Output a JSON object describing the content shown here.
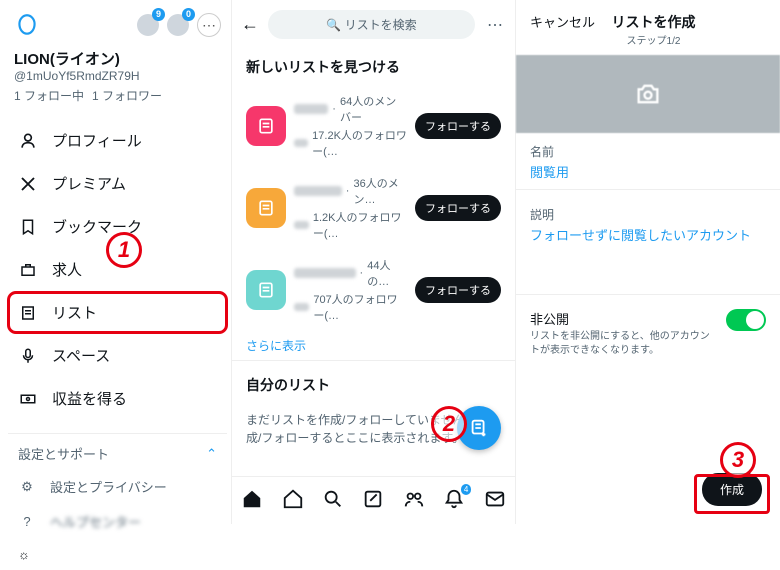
{
  "sidebar": {
    "badge1": "9",
    "badge2": "0",
    "profile": {
      "name": "LION(ライオン)",
      "handle": "@1mUoYf5RmdZR79H",
      "following": "1 フォロー中",
      "followers": "1 フォロワー"
    },
    "items": [
      {
        "key": "profile",
        "label": "プロフィール"
      },
      {
        "key": "premium",
        "label": "プレミアム"
      },
      {
        "key": "bookmark",
        "label": "ブックマーク"
      },
      {
        "key": "jobs",
        "label": "求人"
      },
      {
        "key": "lists",
        "label": "リスト"
      },
      {
        "key": "spaces",
        "label": "スペース"
      },
      {
        "key": "monetize",
        "label": "収益を得る"
      }
    ],
    "sectionLabel": "設定とサポート",
    "sub": {
      "settings": "設定とプライバシー",
      "help": "ヘルプセンター"
    }
  },
  "mid": {
    "searchPlaceholder": "リストを検索",
    "findLists": "新しいリストを見つける",
    "suggestions": [
      {
        "color": "pink",
        "members": "64人のメンバー",
        "followers": "17.2K人のフォロワー(…"
      },
      {
        "color": "orange",
        "members": "36人のメン…",
        "followers": "1.2K人のフォロワー(…"
      },
      {
        "color": "teal",
        "members": "44人の…",
        "followers": "707人のフォロワー(…"
      }
    ],
    "followLabel": "フォローする",
    "moreLink": "さらに表示",
    "ownLists": "自分のリスト",
    "empty": "まだリストを作成/フォローしていません。作成/フォローするとここに表示されます。",
    "notifCount": "4"
  },
  "right": {
    "cancel": "キャンセル",
    "title": "リストを作成",
    "step": "ステップ1/2",
    "nameLabel": "名前",
    "nameValue": "閲覧用",
    "descLabel": "説明",
    "descValue": "フォローせずに閲覧したいアカウント",
    "privateLabel": "非公開",
    "privateHint": "リストを非公開にすると、他のアカウントが表示できなくなります。",
    "createBtn": "作成"
  },
  "annotations": {
    "c1": "1",
    "c2": "2",
    "c3": "3"
  }
}
